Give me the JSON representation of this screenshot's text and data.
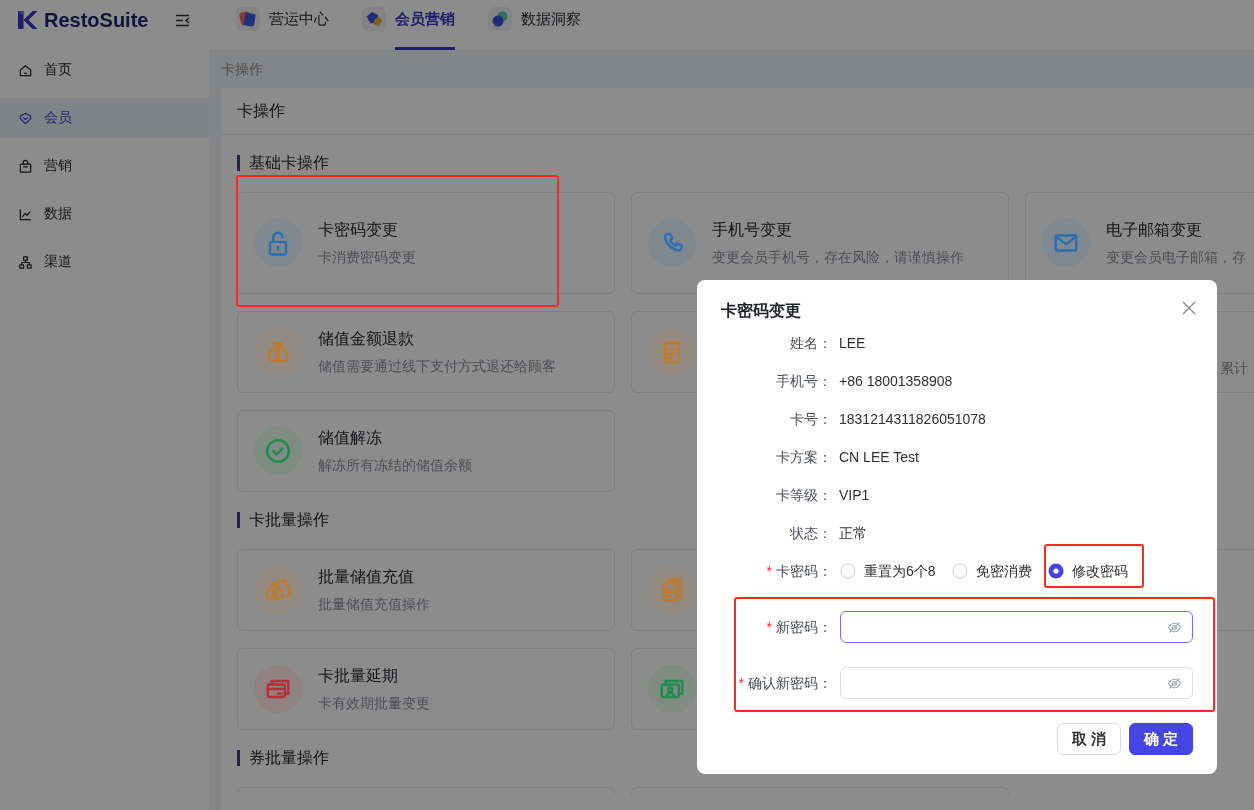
{
  "header": {
    "logo": "RestoSuite",
    "tabs": [
      {
        "label": "营运中心",
        "selected": false
      },
      {
        "label": "会员营销",
        "selected": true
      },
      {
        "label": "数据洞察",
        "selected": false
      }
    ]
  },
  "sidebar": {
    "items": [
      {
        "label": "首页",
        "selected": false
      },
      {
        "label": "会员",
        "selected": true
      },
      {
        "label": "营销",
        "selected": false
      },
      {
        "label": "数据",
        "selected": false
      },
      {
        "label": "渠道",
        "selected": false
      }
    ]
  },
  "breadcrumb": "卡操作",
  "panel": {
    "title": "卡操作",
    "sections": [
      {
        "title": "基础卡操作",
        "cards": [
          {
            "title": "卡密码变更",
            "description": "卡消费密码变更",
            "color": "#2a6fb0",
            "highlighted": true
          },
          {
            "title": "手机号变更",
            "description": "变更会员手机号，存在风险，请谨慎操作",
            "color": "#2a6fb0",
            "highlighted": false
          },
          {
            "title": "电子邮箱变更",
            "description": "变更会员电子邮箱，存",
            "color": "#2a6fb0",
            "highlighted": false
          },
          {
            "title": "储值金额退款",
            "description": "储值需要通过线下支付方式退还给顾客",
            "color": "#c07a2c",
            "highlighted": false
          },
          {
            "color": "#c07a2c",
            "highlighted": false
          },
          {
            "description": "累计",
            "highlighted": false
          },
          {
            "title": "储值解冻",
            "description": "解冻所有冻结的储值余额",
            "color": "#1e8c4a",
            "highlighted": false
          }
        ]
      },
      {
        "title": "卡批量操作",
        "cards": [
          {
            "title": "批量储值充值",
            "description": "批量储值充值操作",
            "color": "#c07a2c",
            "highlighted": false
          },
          {
            "color": "#c07a2c",
            "highlighted": false
          },
          {
            "highlighted": false
          },
          {
            "title": "卡批量延期",
            "description": "卡有效期批量变更",
            "color": "#b03236",
            "highlighted": false
          },
          {
            "color": "#1e8c4a",
            "highlighted": false
          }
        ]
      },
      {
        "title": "券批量操作",
        "cards": [
          {
            "highlighted": false
          },
          {
            "highlighted": false
          }
        ]
      }
    ]
  },
  "dialog": {
    "title": "卡密码变更",
    "info": [
      {
        "label": "姓名：",
        "value": "LEE"
      },
      {
        "label": "手机号：",
        "value": "+86 18001358908"
      },
      {
        "label": "卡号：",
        "value": "1831214311826051078"
      },
      {
        "label": "卡方案：",
        "value": "CN LEE Test"
      },
      {
        "label": "卡等级：",
        "value": "VIP1"
      },
      {
        "label": "状态：",
        "value": "正常"
      }
    ],
    "password": {
      "mark": "*",
      "label": "卡密码：",
      "options": [
        {
          "label": "重置为6个8",
          "selected": false,
          "highlighted": false
        },
        {
          "label": "免密消费",
          "selected": false,
          "highlighted": false
        },
        {
          "label": "修改密码",
          "selected": true,
          "highlighted": true
        }
      ]
    },
    "fields_highlighted": true,
    "fields": [
      {
        "mark": "*",
        "label": "新密码：",
        "focused": true
      },
      {
        "mark": "*",
        "label": "确认新密码：",
        "focused": false
      }
    ],
    "buttons": [
      {
        "label": "取 消",
        "kind": "secondary"
      },
      {
        "label": "确 定",
        "kind": "primary"
      }
    ]
  }
}
